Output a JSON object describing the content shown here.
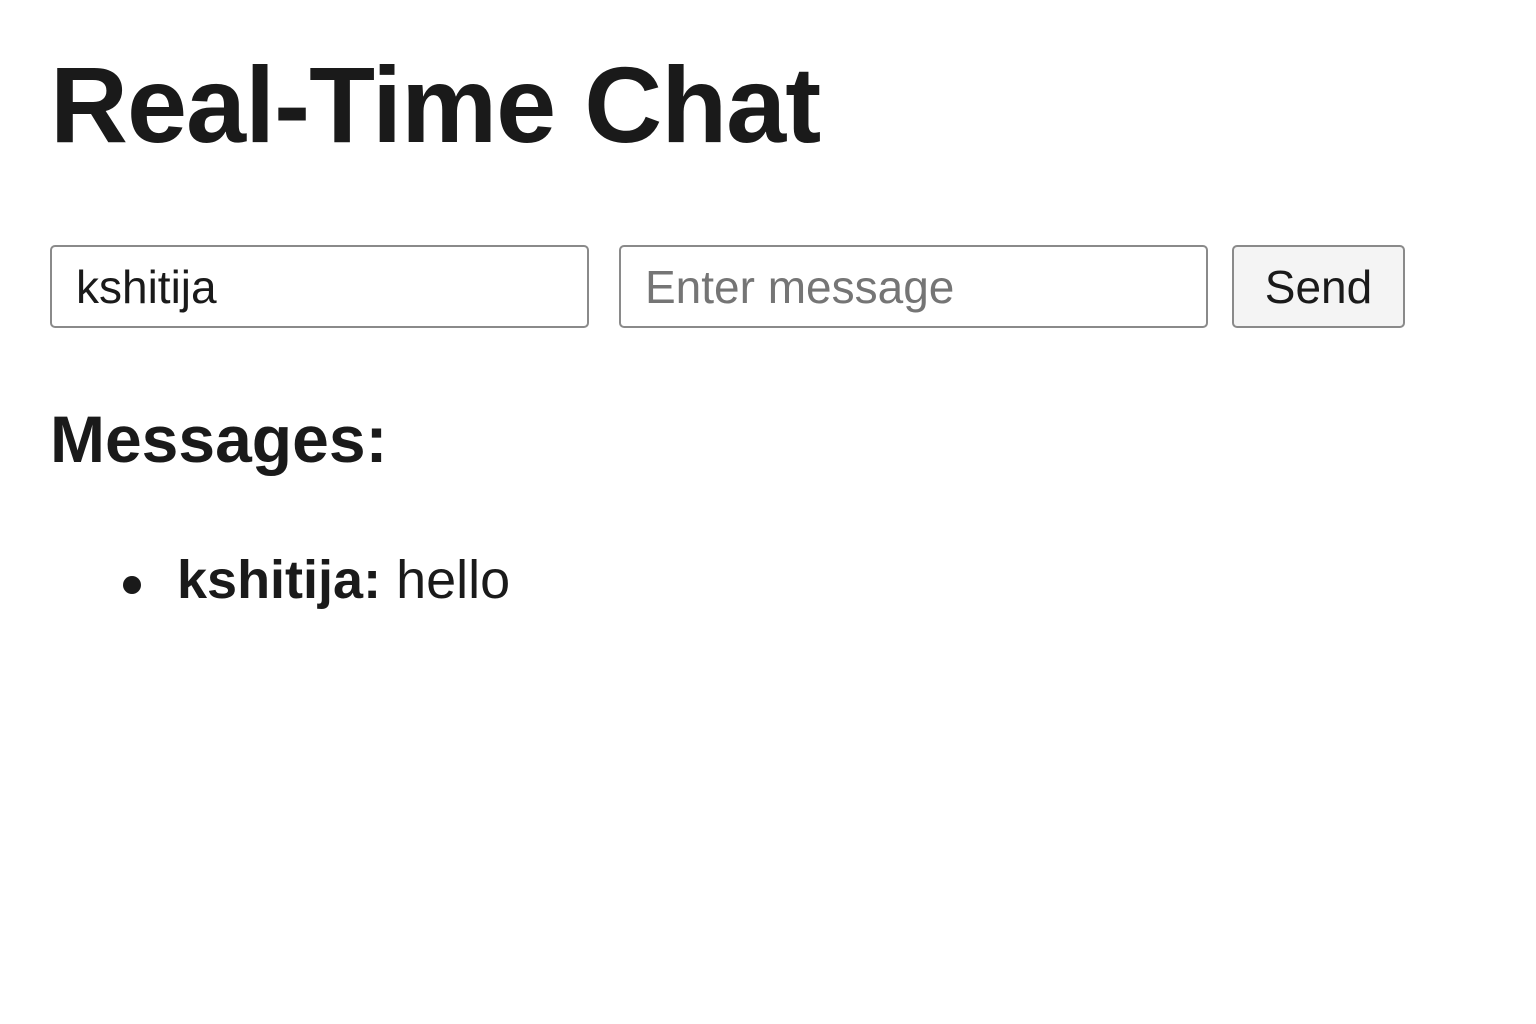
{
  "header": {
    "title": "Real-Time Chat"
  },
  "form": {
    "username_value": "kshitija",
    "message_placeholder": "Enter message",
    "message_value": "",
    "send_label": "Send"
  },
  "messages": {
    "heading": "Messages:",
    "items": [
      {
        "user": "kshitija:",
        "text": " hello"
      }
    ]
  }
}
